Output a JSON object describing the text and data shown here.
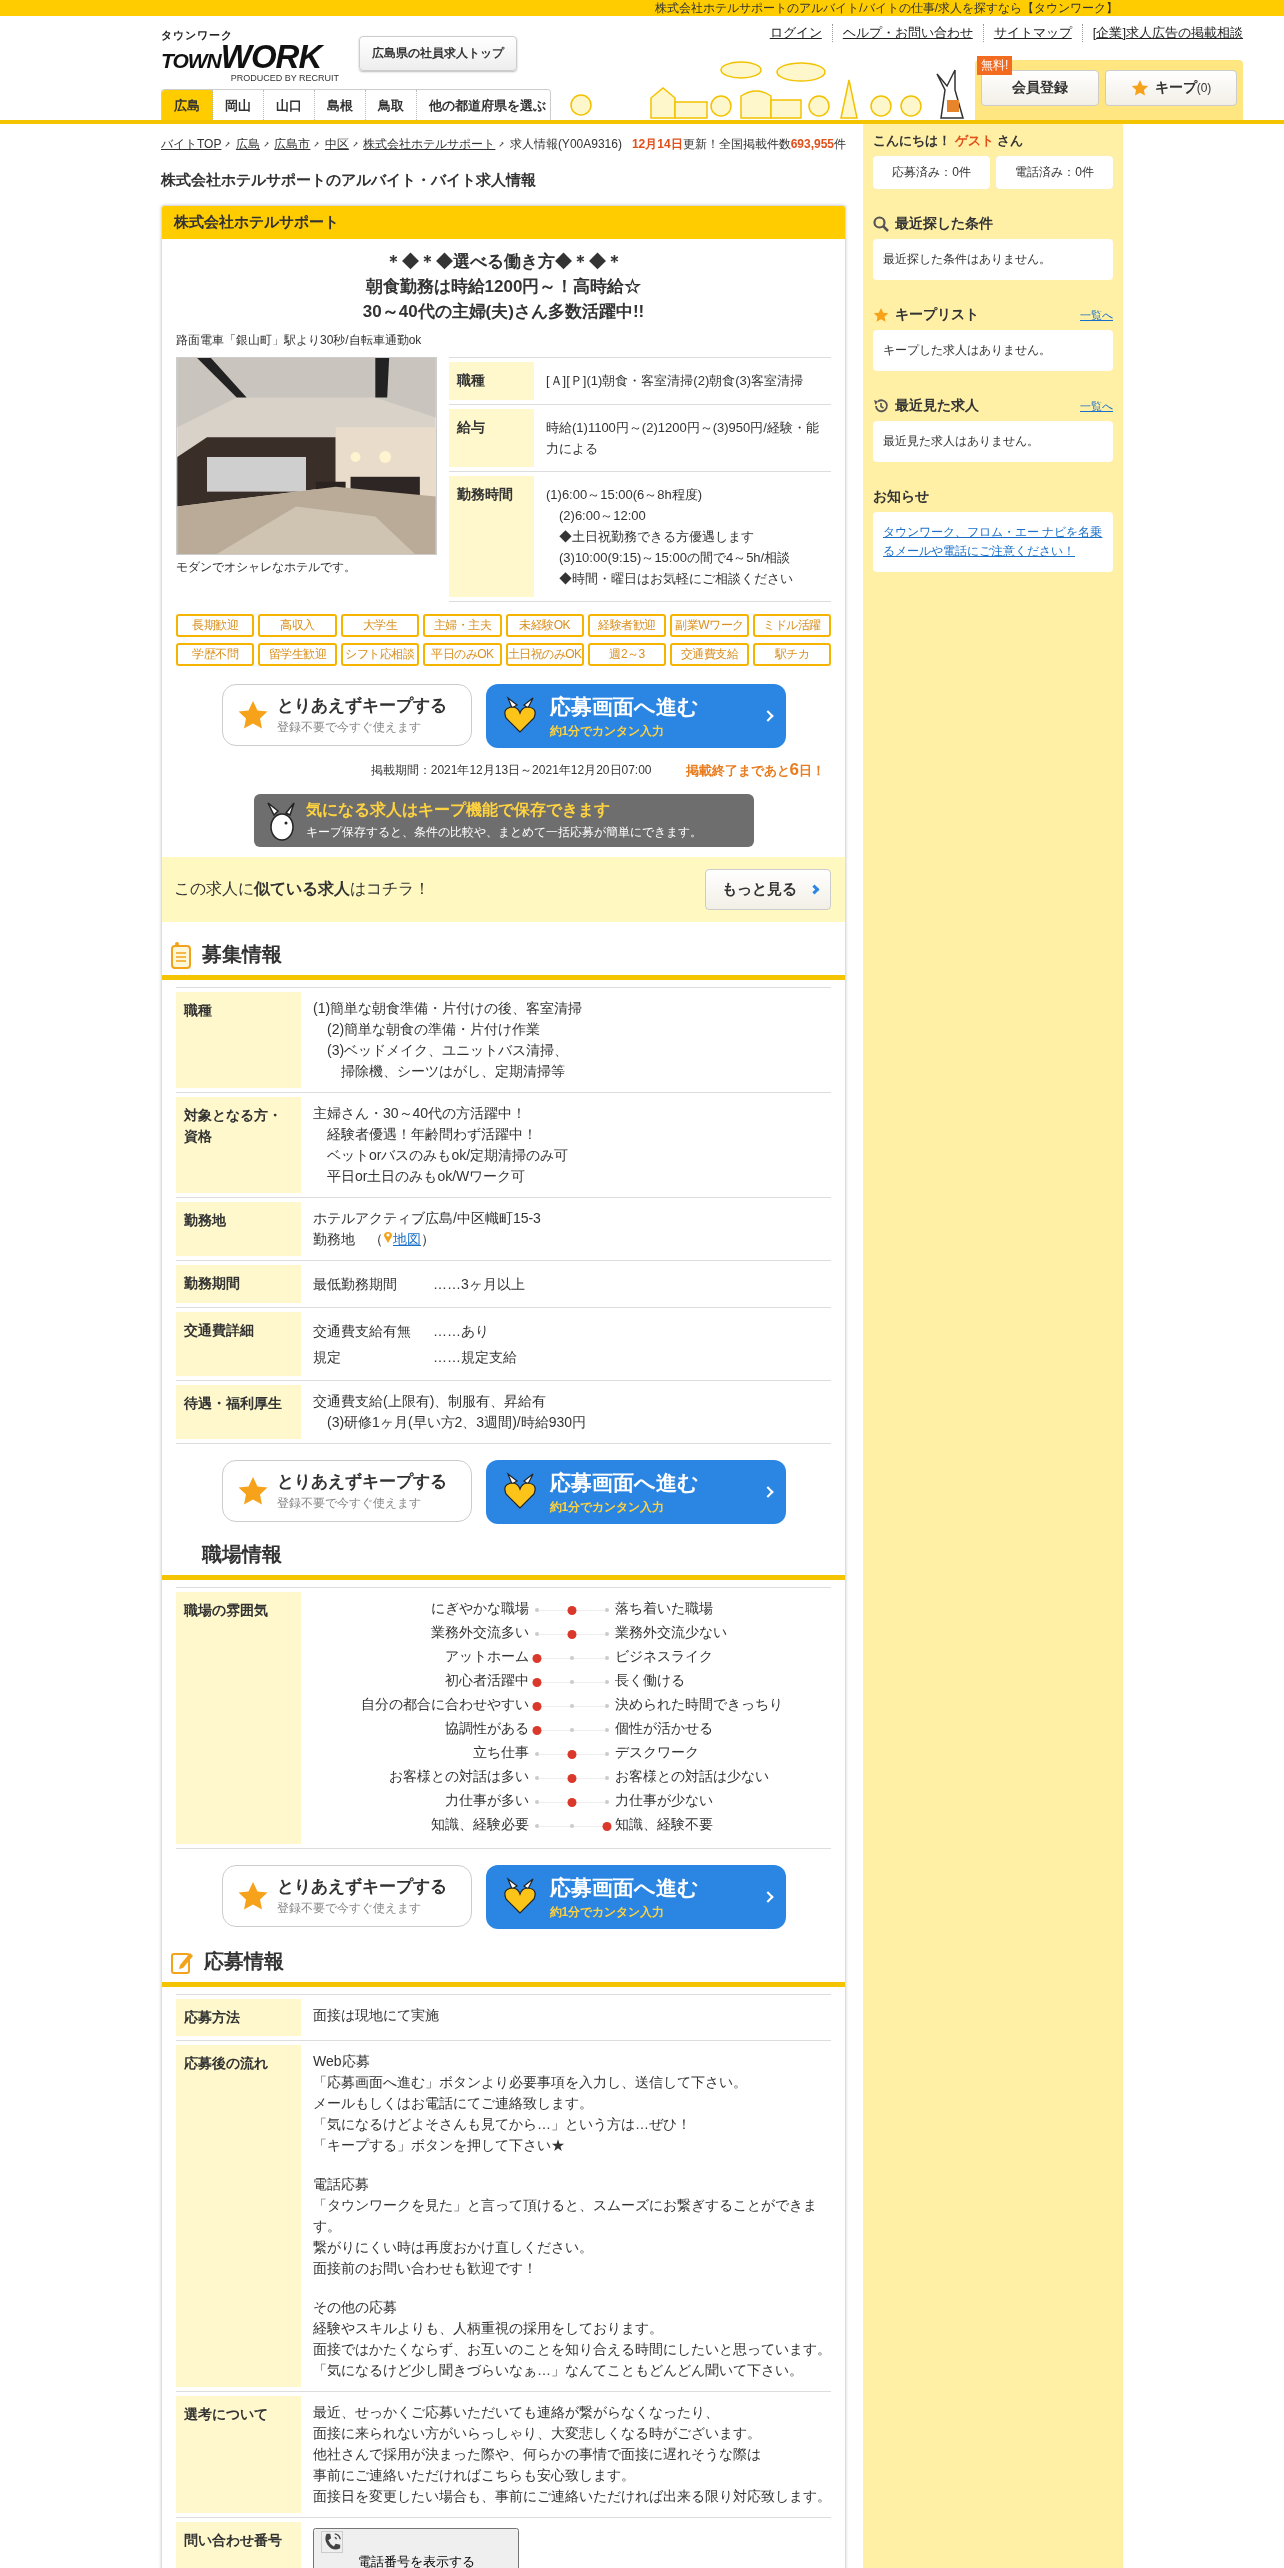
{
  "top_strip": {
    "text": "株式会社ホテルサポートのアルバイト/バイトの仕事/求人を探すなら【タウンワーク】"
  },
  "header": {
    "logo": {
      "kana": "タウンワーク",
      "word_a": "TOWN",
      "word_b": "WORK",
      "produced": "PRODUCED BY RECRUIT"
    },
    "top_button": "広島県の社員求人トップ",
    "links": [
      "ログイン",
      "ヘルプ・お問い合わせ",
      "サイトマップ",
      "[企業]求人広告の掲載相談"
    ],
    "prefecture_tabs": [
      {
        "label": "広島",
        "selected": true
      },
      {
        "label": "岡山",
        "selected": false
      },
      {
        "label": "山口",
        "selected": false
      },
      {
        "label": "島根",
        "selected": false
      },
      {
        "label": "鳥取",
        "selected": false
      },
      {
        "label": "他の都道府県を選ぶ",
        "selected": false
      }
    ],
    "member_button": {
      "label": "会員登録",
      "badge": "無料!"
    },
    "keep_button": {
      "label": "キープ",
      "count": "(0)"
    }
  },
  "breadcrumb": {
    "items": [
      "バイトTOP",
      "広島",
      "広島市",
      "中区",
      "株式会社ホテルサポート"
    ],
    "current": "求人情報(Y00A9316)",
    "update": "**12月14日**更新！全国掲載件数**693,955**件"
  },
  "page_title": "株式会社ホテルサポートのアルバイト・バイト求人情報",
  "job": {
    "company": "株式会社ホテルサポート",
    "headline": [
      "＊◆＊◆選べる働き方◆＊◆＊",
      "朝食勤務は時給1200円～！高時給☆",
      "30～40代の主婦(夫)さん多数活躍中!!"
    ],
    "access": "路面電車「銀山町」駅より30秒/自転車通勤ok",
    "photo": {
      "kind": "picture",
      "caption": "モダンでオシャレなホテルです。"
    },
    "summary": [
      {
        "label": "職種",
        "lines": [
          "[Ａ][Ｐ](1)朝食・客室清掃(2)朝食(3)客室清掃"
        ]
      },
      {
        "label": "給与",
        "lines": [
          "時給(1)1100円～(2)1200円～(3)950円/経験・能力による"
        ]
      },
      {
        "label": "勤務時間",
        "lines": [
          "(1)6:00～15:00(6～8h程度)",
          "　(2)6:00～12:00",
          "　◆土日祝勤務できる方優遇します",
          "　(3)10:00(9:15)～15:00の間で4～5h/相談",
          "　◆時間・曜日はお気軽にご相談ください"
        ]
      }
    ],
    "tags": [
      "長期歓迎",
      "高収入",
      "大学生",
      "主婦・主夫",
      "未経験OK",
      "経験者歓迎",
      "副業Wワーク",
      "ミドル活躍",
      "学歴不問",
      "留学生歓迎",
      "シフト応相談",
      "平日のみOK",
      "土日祝のみOK",
      "週2～3",
      "交通費支給",
      "駅チカ"
    ],
    "actions": {
      "keep_title": "とりあえずキープする",
      "keep_sub": "登録不要で今すぐ使えます",
      "apply_title": "応募画面へ進む",
      "apply_sub": "約1分でカンタン入力"
    },
    "period": "掲載期間：2021年12月13日～2021年12月20日07:00",
    "remaining": "掲載終了まであと**6**日！",
    "keep_banner": {
      "title": "気になる求人はキープ機能で保存できます",
      "text": "キープ保存すると、条件の比較や、まとめて一括応募が簡単にできます。"
    },
    "similar": {
      "text": "この求人に**似ている求人**はコチラ！",
      "button": "もっと見る"
    }
  },
  "recruitment": {
    "title": "募集情報",
    "rows": [
      {
        "kind": "lines",
        "label": "職種",
        "paragraphs": [
          [
            "(1)簡単な朝食準備・片付けの後、客室清掃",
            "　(2)簡単な朝食の準備・片付け作業",
            "　(3)ベッドメイク、ユニットバス清掃、",
            "　　掃除機、シーツはがし、定期清掃等"
          ]
        ]
      },
      {
        "kind": "lines",
        "label": "対象となる方・資格",
        "paragraphs": [
          [
            "主婦さん・30～40代の方活躍中！",
            "　経験者優遇！年齢問わず活躍中！",
            "　ベットorバスのみもok/定期清掃のみ可",
            "　平日or土日のみもok/Wワーク可"
          ]
        ]
      },
      {
        "kind": "map",
        "label": "勤務地",
        "paragraphs": [
          [
            "ホテルアクティブ広島/中区幟町15-3"
          ]
        ],
        "map": {
          "prefix": "勤務地　（",
          "link": "地図",
          "suffix": "）"
        }
      },
      {
        "kind": "pairs",
        "label": "勤務期間",
        "pairs": [
          {
            "key": "最低勤務期間",
            "value": "……3ヶ月以上"
          }
        ]
      },
      {
        "kind": "pairs",
        "label": "交通費詳細",
        "pairs": [
          {
            "key": "交通費支給有無",
            "value": "……あり"
          },
          {
            "key": "規定",
            "value": "……規定支給"
          }
        ]
      },
      {
        "kind": "lines",
        "label": "待遇・福利厚生",
        "paragraphs": [
          [
            "交通費支給(上限有)、制服有、昇給有",
            "　(3)研修1ヶ月(早い方2、3週間)/時給930円"
          ]
        ]
      }
    ],
    "actions": {
      "keep_title": "とりあえずキープする",
      "keep_sub": "登録不要で今すぐ使えます",
      "apply_title": "応募画面へ進む",
      "apply_sub": "約1分でカンタン入力"
    }
  },
  "workplace": {
    "title": "職場情報",
    "atmosphere": {
      "label": "職場の雰囲気",
      "scales": [
        {
          "left": "にぎやかな職場",
          "right": "落ち着いた職場",
          "level": 0.5
        },
        {
          "left": "業務外交流多い",
          "right": "業務外交流少ない",
          "level": 0.5
        },
        {
          "left": "アットホーム",
          "right": "ビジネスライク",
          "level": 0
        },
        {
          "left": "初心者活躍中",
          "right": "長く働ける",
          "level": 0
        },
        {
          "left": "自分の都合に合わせやすい",
          "right": "決められた時間できっちり",
          "level": 0
        },
        {
          "left": "協調性がある",
          "right": "個性が活かせる",
          "level": 0
        },
        {
          "left": "立ち仕事",
          "right": "デスクワーク",
          "level": 0.5
        },
        {
          "left": "お客様との対話は多い",
          "right": "お客様との対話は少ない",
          "level": 0.5
        },
        {
          "left": "力仕事が多い",
          "right": "力仕事が少ない",
          "level": 0.5
        },
        {
          "left": "知識、経験必要",
          "right": "知識、経験不要",
          "level": 1
        }
      ]
    },
    "actions": {
      "keep_title": "とりあえずキープする",
      "keep_sub": "登録不要で今すぐ使えます",
      "apply_title": "応募画面へ進む",
      "apply_sub": "約1分でカンタン入力"
    }
  },
  "application": {
    "title": "応募情報",
    "rows": [
      {
        "kind": "lines",
        "label": "応募方法",
        "paragraphs": [
          [
            "面接は現地にて実施"
          ]
        ]
      },
      {
        "kind": "lines",
        "label": "応募後の流れ",
        "paragraphs": [
          [
            "Web応募",
            "「応募画面へ進む」ボタンより必要事項を入力し、送信して下さい。",
            "メールもしくはお電話にてご連絡致します。",
            "「気になるけどよそさんも見てから…」という方は…ぜひ！",
            "「キープする」ボタンを押して下さい★"
          ],
          [
            "電話応募",
            "「タウンワークを見た」と言って頂けると、スムーズにお繋ぎすることができます。",
            "繋がりにくい時は再度おかけ直しください。",
            "面接前のお問い合わせも歓迎です！"
          ],
          [
            "その他の応募",
            "経験やスキルよりも、人柄重視の採用をしております。",
            "面接ではかたくならず、お互いのことを知り合える時間にしたいと思っています。",
            "「気になるけど少し聞きづらいなぁ…」なんてこともどんどん聞いて下さい。"
          ]
        ]
      },
      {
        "kind": "lines",
        "label": "選考について",
        "paragraphs": [
          [
            "最近、せっかくご応募いただいても連絡が繋がらなくなったり、",
            "面接に来られない方がいらっしゃり、大変悲しくなる時がございます。",
            "他社さんで採用が決まった際や、何らかの事情で面接に遅れそうな際は",
            "事前にご連絡いただければこちらも安心致します。",
            "面接日を変更したい場合も、事前にご連絡いただければ出来る限り対応致します。"
          ]
        ]
      },
      {
        "kind": "phone",
        "label": "問い合わせ番号",
        "button": "電話番号を表示する"
      }
    ]
  },
  "sidebar": {
    "greeting": "こんにちは！ **ゲスト** さん",
    "counts": [
      "応募済み：0件",
      "電話済み：0件"
    ],
    "sections": [
      {
        "kind": "search",
        "title": "最近探した条件",
        "message": "最近探した条件はありません。"
      },
      {
        "kind": "star",
        "title": "キープリスト",
        "link": "一覧へ",
        "message": "キープした求人はありません。"
      },
      {
        "kind": "history",
        "title": "最近見た求人",
        "link": "一覧へ",
        "message": "最近見た求人はありません。"
      },
      {
        "kind": "notice",
        "title": "お知らせ",
        "notice_link": "タウンワーク、フロム・エー ナビを名乗るメールや電話にご注意ください！"
      }
    ]
  }
}
